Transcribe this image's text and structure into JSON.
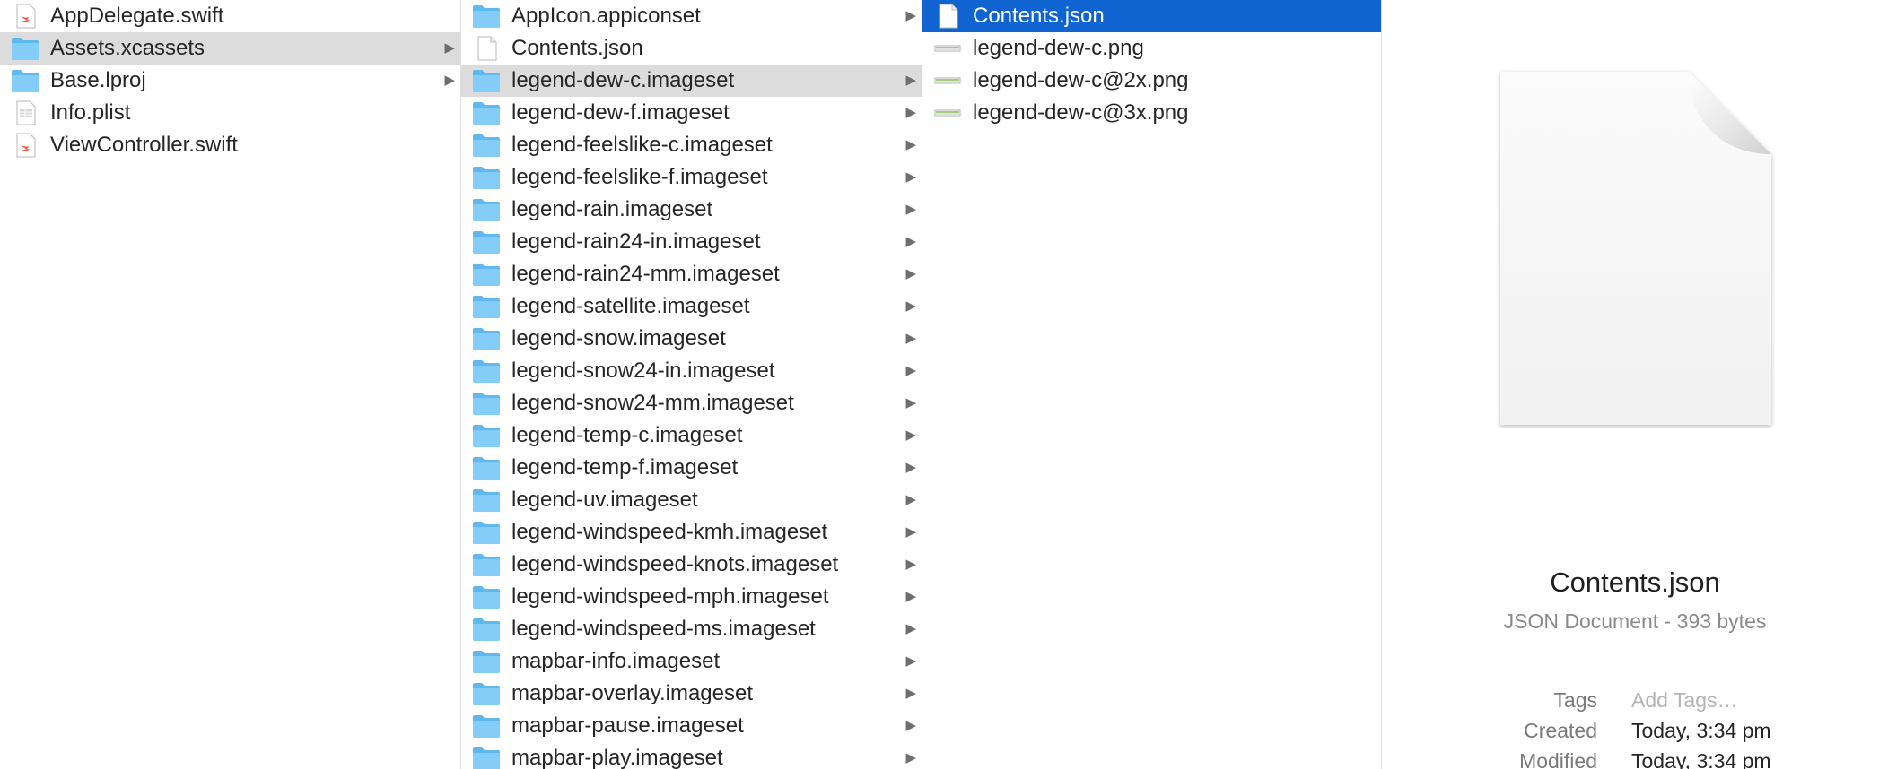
{
  "columns": {
    "project": {
      "items": [
        {
          "label": "AppDelegate.swift",
          "icon": "swift-file-icon",
          "chevron": false,
          "state": "normal"
        },
        {
          "label": "Assets.xcassets",
          "icon": "folder-icon",
          "chevron": true,
          "state": "highlighted"
        },
        {
          "label": "Base.lproj",
          "icon": "folder-icon",
          "chevron": true,
          "state": "normal"
        },
        {
          "label": "Info.plist",
          "icon": "plist-file-icon",
          "chevron": false,
          "state": "normal"
        },
        {
          "label": "ViewController.swift",
          "icon": "swift-file-icon",
          "chevron": false,
          "state": "normal"
        }
      ]
    },
    "assets": {
      "items": [
        {
          "label": "AppIcon.appiconset",
          "icon": "folder-icon",
          "chevron": true,
          "state": "normal"
        },
        {
          "label": "Contents.json",
          "icon": "document-icon",
          "chevron": false,
          "state": "normal"
        },
        {
          "label": "legend-dew-c.imageset",
          "icon": "folder-icon",
          "chevron": true,
          "state": "highlighted"
        },
        {
          "label": "legend-dew-f.imageset",
          "icon": "folder-icon",
          "chevron": true,
          "state": "normal"
        },
        {
          "label": "legend-feelslike-c.imageset",
          "icon": "folder-icon",
          "chevron": true,
          "state": "normal"
        },
        {
          "label": "legend-feelslike-f.imageset",
          "icon": "folder-icon",
          "chevron": true,
          "state": "normal"
        },
        {
          "label": "legend-rain.imageset",
          "icon": "folder-icon",
          "chevron": true,
          "state": "normal"
        },
        {
          "label": "legend-rain24-in.imageset",
          "icon": "folder-icon",
          "chevron": true,
          "state": "normal"
        },
        {
          "label": "legend-rain24-mm.imageset",
          "icon": "folder-icon",
          "chevron": true,
          "state": "normal"
        },
        {
          "label": "legend-satellite.imageset",
          "icon": "folder-icon",
          "chevron": true,
          "state": "normal"
        },
        {
          "label": "legend-snow.imageset",
          "icon": "folder-icon",
          "chevron": true,
          "state": "normal"
        },
        {
          "label": "legend-snow24-in.imageset",
          "icon": "folder-icon",
          "chevron": true,
          "state": "normal"
        },
        {
          "label": "legend-snow24-mm.imageset",
          "icon": "folder-icon",
          "chevron": true,
          "state": "normal"
        },
        {
          "label": "legend-temp-c.imageset",
          "icon": "folder-icon",
          "chevron": true,
          "state": "normal"
        },
        {
          "label": "legend-temp-f.imageset",
          "icon": "folder-icon",
          "chevron": true,
          "state": "normal"
        },
        {
          "label": "legend-uv.imageset",
          "icon": "folder-icon",
          "chevron": true,
          "state": "normal"
        },
        {
          "label": "legend-windspeed-kmh.imageset",
          "icon": "folder-icon",
          "chevron": true,
          "state": "normal"
        },
        {
          "label": "legend-windspeed-knots.imageset",
          "icon": "folder-icon",
          "chevron": true,
          "state": "normal"
        },
        {
          "label": "legend-windspeed-mph.imageset",
          "icon": "folder-icon",
          "chevron": true,
          "state": "normal"
        },
        {
          "label": "legend-windspeed-ms.imageset",
          "icon": "folder-icon",
          "chevron": true,
          "state": "normal"
        },
        {
          "label": "mapbar-info.imageset",
          "icon": "folder-icon",
          "chevron": true,
          "state": "normal"
        },
        {
          "label": "mapbar-overlay.imageset",
          "icon": "folder-icon",
          "chevron": true,
          "state": "normal"
        },
        {
          "label": "mapbar-pause.imageset",
          "icon": "folder-icon",
          "chevron": true,
          "state": "normal"
        },
        {
          "label": "mapbar-play.imageset",
          "icon": "folder-icon",
          "chevron": true,
          "state": "normal"
        }
      ]
    },
    "imageset": {
      "items": [
        {
          "label": "Contents.json",
          "icon": "document-icon",
          "chevron": false,
          "state": "selected"
        },
        {
          "label": "legend-dew-c.png",
          "icon": "png-image-icon",
          "chevron": false,
          "state": "normal"
        },
        {
          "label": "legend-dew-c@2x.png",
          "icon": "png-image-icon",
          "chevron": false,
          "state": "normal"
        },
        {
          "label": "legend-dew-c@3x.png",
          "icon": "png-image-icon",
          "chevron": false,
          "state": "normal"
        }
      ]
    }
  },
  "preview": {
    "icon": "large-document-icon",
    "name": "Contents.json",
    "kind": "JSON Document - 393 bytes",
    "tags_label": "Tags",
    "tags_placeholder": "Add Tags…",
    "created_label": "Created",
    "created_value": "Today, 3:34 pm",
    "modified_label": "Modified",
    "modified_value": "Today, 3:34 pm"
  },
  "colors": {
    "selection": "#0f64d2",
    "highlight": "#dcdcdc",
    "folder": "#6cc2f5",
    "swift": "#f05138"
  }
}
